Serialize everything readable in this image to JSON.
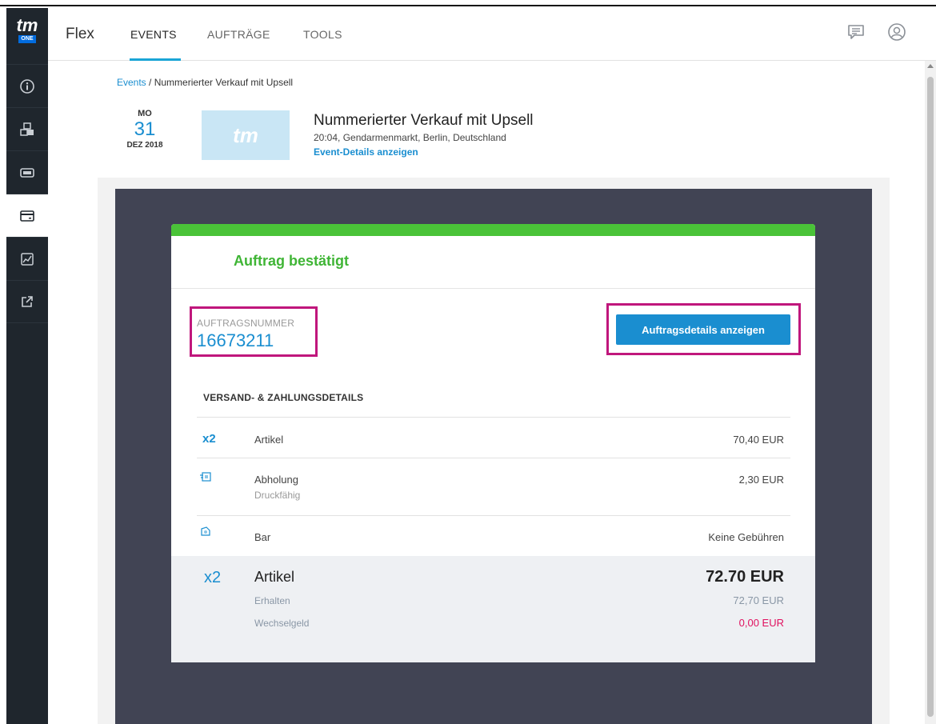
{
  "colors": {
    "accent": "#1a8ed0",
    "success": "#4ac338",
    "highlight": "#c0177c",
    "sidebar": "#1f262d",
    "change_value": "#e0115f"
  },
  "sidebar": {
    "logo_text": "tm",
    "logo_badge": "ONE",
    "items": [
      {
        "icon": "info-icon"
      },
      {
        "icon": "cubes-icon"
      },
      {
        "icon": "ticket-icon"
      },
      {
        "icon": "card-icon"
      },
      {
        "icon": "chart-icon"
      },
      {
        "icon": "external-link-icon"
      }
    ]
  },
  "topnav": {
    "brand": "Flex",
    "tabs": [
      {
        "label": "EVENTS",
        "active": true
      },
      {
        "label": "AUFTRÄGE",
        "active": false
      },
      {
        "label": "TOOLS",
        "active": false
      }
    ],
    "icons": [
      "chat-icon",
      "user-icon"
    ]
  },
  "breadcrumb": {
    "link": "Events",
    "separator": " / ",
    "current": "Nummerierter Verkauf mit Upsell"
  },
  "event": {
    "day_of_week": "MO",
    "day": "31",
    "month_year": "DEZ 2018",
    "thumb_text": "tm",
    "title": "Nummerierter Verkauf mit Upsell",
    "subtitle": "20:04, Gendarmenmarkt, Berlin, Deutschland",
    "details_link": "Event-Details anzeigen"
  },
  "order": {
    "status_title": "Auftrag bestätigt",
    "number_label": "AUFTRAGSNUMMER",
    "number": "16673211",
    "details_button": "Auftragsdetails anzeigen"
  },
  "details": {
    "section_title": "VERSAND- & ZAHLUNGSDETAILS",
    "rows": [
      {
        "qty": "x2",
        "label": "Artikel",
        "sublabel": "",
        "value": "70,40 EUR"
      },
      {
        "icon": "delivery-icon",
        "label": "Abholung",
        "sublabel": "Druckfähig",
        "value": "2,30 EUR"
      },
      {
        "icon": "cash-icon",
        "label": "Bar",
        "sublabel": "",
        "value": "Keine Gebühren"
      }
    ]
  },
  "summary": {
    "qty": "x2",
    "label": "Artikel",
    "total": "72.70 EUR",
    "received_label": "Erhalten",
    "received_value": "72,70 EUR",
    "change_label": "Wechselgeld",
    "change_value": "0,00 EUR"
  }
}
